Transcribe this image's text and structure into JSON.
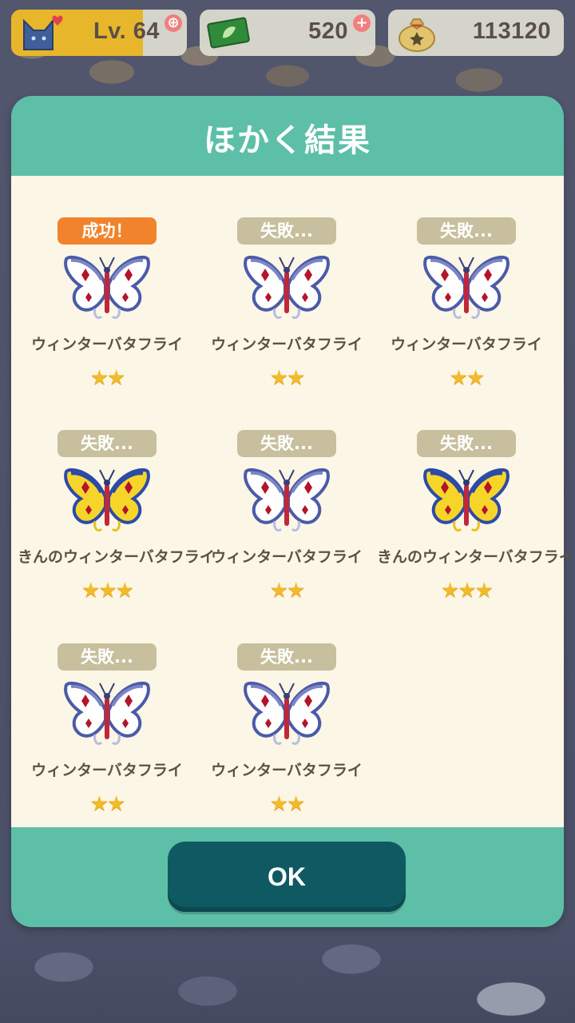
{
  "hud": {
    "level_label": "Lv. 64",
    "level_progress": 0.75,
    "tickets": "520",
    "bells": "113120"
  },
  "dialog": {
    "title": "ほかく結果",
    "ok_label": "OK",
    "results": [
      {
        "status": "成功！",
        "success": true,
        "name": "ウィンターバタフライ",
        "stars": "★★",
        "variant": "white"
      },
      {
        "status": "失敗...",
        "success": false,
        "name": "ウィンターバタフライ",
        "stars": "★★",
        "variant": "white"
      },
      {
        "status": "失敗...",
        "success": false,
        "name": "ウィンターバタフライ",
        "stars": "★★",
        "variant": "white"
      },
      {
        "status": "失敗...",
        "success": false,
        "name": "きんのウィンターバタフライ",
        "stars": "★★★",
        "variant": "gold"
      },
      {
        "status": "失敗...",
        "success": false,
        "name": "ウィンターバタフライ",
        "stars": "★★",
        "variant": "white"
      },
      {
        "status": "失敗...",
        "success": false,
        "name": "きんのウィンターバタフライ",
        "stars": "★★★",
        "variant": "gold"
      },
      {
        "status": "失敗...",
        "success": false,
        "name": "ウィンターバタフライ",
        "stars": "★★",
        "variant": "white"
      },
      {
        "status": "失敗...",
        "success": false,
        "name": "ウィンターバタフライ",
        "stars": "★★",
        "variant": "white"
      }
    ]
  },
  "colors": {
    "accent_teal": "#5dbfa8",
    "ok_button": "#0f5a62",
    "success_badge": "#f0832b",
    "fail_badge": "#c7bf9d",
    "star": "#f2bb2c"
  },
  "icons": {
    "level": "cat-face-heart-icon",
    "tickets": "leaf-ticket-icon",
    "bells": "bell-bag-icon",
    "butterfly_white": "winter-butterfly-icon",
    "butterfly_gold": "golden-winter-butterfly-icon"
  }
}
